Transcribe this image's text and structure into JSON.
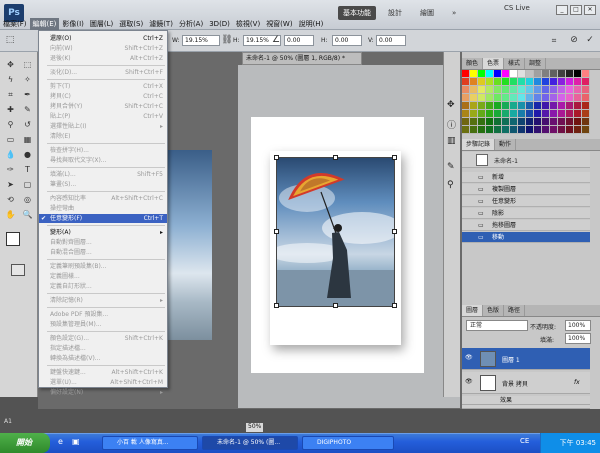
{
  "app": {
    "logo": "Ps",
    "workspace_active": "基本功能",
    "workspace_design": "設計",
    "workspace_paint": "繪圖",
    "more": "»",
    "cs_live": "CS Live"
  },
  "menubar": {
    "items": [
      "檔案(F)",
      "編輯(E)",
      "影像(I)",
      "圖層(L)",
      "選取(S)",
      "濾鏡(T)",
      "分析(A)",
      "3D(D)",
      "檢視(V)",
      "視窗(W)",
      "說明(H)"
    ],
    "open_index": 1
  },
  "options": {
    "w_label": "W:",
    "w_value": "19.15%",
    "h_label": "H:",
    "h_value": "19.15%",
    "angle_value": "0.00",
    "h_skew": "H:",
    "h_skew_value": "0.00",
    "v_skew": "V:",
    "v_skew_value": "0.00"
  },
  "edit_menu": {
    "items": [
      {
        "label": "還原(O)",
        "shortcut": "Ctrl+Z",
        "state": "en"
      },
      {
        "label": "向前(W)",
        "shortcut": "Shift+Ctrl+Z",
        "state": "dis"
      },
      {
        "label": "退後(K)",
        "shortcut": "Alt+Ctrl+Z",
        "state": "dis"
      },
      {
        "label": "淡化(D)...",
        "shortcut": "Shift+Ctrl+F",
        "state": "dis"
      },
      {
        "label": "剪下(T)",
        "shortcut": "Ctrl+X",
        "state": "dis"
      },
      {
        "label": "拷貝(C)",
        "shortcut": "Ctrl+C",
        "state": "dis"
      },
      {
        "label": "拷貝合併(Y)",
        "shortcut": "Shift+Ctrl+C",
        "state": "dis"
      },
      {
        "label": "貼上(P)",
        "shortcut": "Ctrl+V",
        "state": "dis"
      },
      {
        "label": "選擇性貼上(I)",
        "shortcut": "▸",
        "state": "dis"
      },
      {
        "label": "清除(E)",
        "shortcut": "",
        "state": "dis"
      },
      {
        "label": "檢查拼字(H)...",
        "shortcut": "",
        "state": "dis"
      },
      {
        "label": "尋找與取代文字(X)...",
        "shortcut": "",
        "state": "dis"
      },
      {
        "label": "填滿(L)...",
        "shortcut": "Shift+F5",
        "state": "dis"
      },
      {
        "label": "筆畫(S)...",
        "shortcut": "",
        "state": "dis"
      },
      {
        "label": "內容感知比率",
        "shortcut": "Alt+Shift+Ctrl+C",
        "state": "dis"
      },
      {
        "label": "操控彎曲",
        "shortcut": "",
        "state": "dis"
      },
      {
        "label": "任意變形(F)",
        "shortcut": "Ctrl+T",
        "state": "hl"
      },
      {
        "label": "變形(A)",
        "shortcut": "▸",
        "state": "en"
      },
      {
        "label": "自動對齊圖層...",
        "shortcut": "",
        "state": "dis"
      },
      {
        "label": "自動混合圖層...",
        "shortcut": "",
        "state": "dis"
      },
      {
        "label": "定義筆刷預設集(B)...",
        "shortcut": "",
        "state": "dis"
      },
      {
        "label": "定義圖樣...",
        "shortcut": "",
        "state": "dis"
      },
      {
        "label": "定義自訂形狀...",
        "shortcut": "",
        "state": "dis"
      },
      {
        "label": "清除記憶(R)",
        "shortcut": "▸",
        "state": "dis"
      },
      {
        "label": "Adobe PDF 預設集...",
        "shortcut": "",
        "state": "dis"
      },
      {
        "label": "預設集管理員(M)...",
        "shortcut": "",
        "state": "dis"
      },
      {
        "label": "顏色設定(G)...",
        "shortcut": "Shift+Ctrl+K",
        "state": "dis"
      },
      {
        "label": "指定描述檔...",
        "shortcut": "",
        "state": "dis"
      },
      {
        "label": "轉換為描述檔(V)...",
        "shortcut": "",
        "state": "dis"
      },
      {
        "label": "鍵盤快速鍵...",
        "shortcut": "Alt+Shift+Ctrl+K",
        "state": "dis"
      },
      {
        "label": "選單(U)...",
        "shortcut": "Alt+Shift+Ctrl+M",
        "state": "dis"
      },
      {
        "label": "偏好設定(N)",
        "shortcut": "▸",
        "state": "dis"
      }
    ]
  },
  "document": {
    "tab_title": "未命名-1 @ 50% (圖層 1, RGB/8) *",
    "zoom": "50%"
  },
  "panels": {
    "swatch_tabs": [
      "顏色",
      "色票",
      "樣式",
      "調整"
    ],
    "swatch_selected": 1,
    "history_tabs": [
      "步驟記錄",
      "動作"
    ],
    "history_doc": "未命名-1",
    "history_items": [
      "新增",
      "複製圖層",
      "任意變形",
      "陰影",
      "拖移圖層",
      "移動"
    ],
    "history_selected": 5,
    "layers_tabs": [
      "圖層",
      "色版",
      "路徑"
    ],
    "blend_mode": "正常",
    "opacity_label": "不透明度:",
    "opacity_value": "100%",
    "fill_label": "填滿:",
    "fill_value": "100%",
    "layers": [
      {
        "name": "圖層 1",
        "selected": true
      },
      {
        "name": "背景 拷貝",
        "selected": false
      }
    ],
    "effects_label": "效果",
    "shadow_label": "陰影",
    "fx_label": "fx"
  },
  "left_doc_tab": "A1",
  "taskbar": {
    "start": "開始",
    "tasks": [
      {
        "label": "小百 載 人像寫真..."
      },
      {
        "label": "未命名-1 @ 50% (圖..."
      },
      {
        "label": "DIGIPHOTO"
      }
    ],
    "lang": "CE",
    "clock": "下午 03:45"
  },
  "colors": {
    "accent": "#3b62c2",
    "taskbar": "#245edb",
    "start": "#2f8a2b"
  }
}
